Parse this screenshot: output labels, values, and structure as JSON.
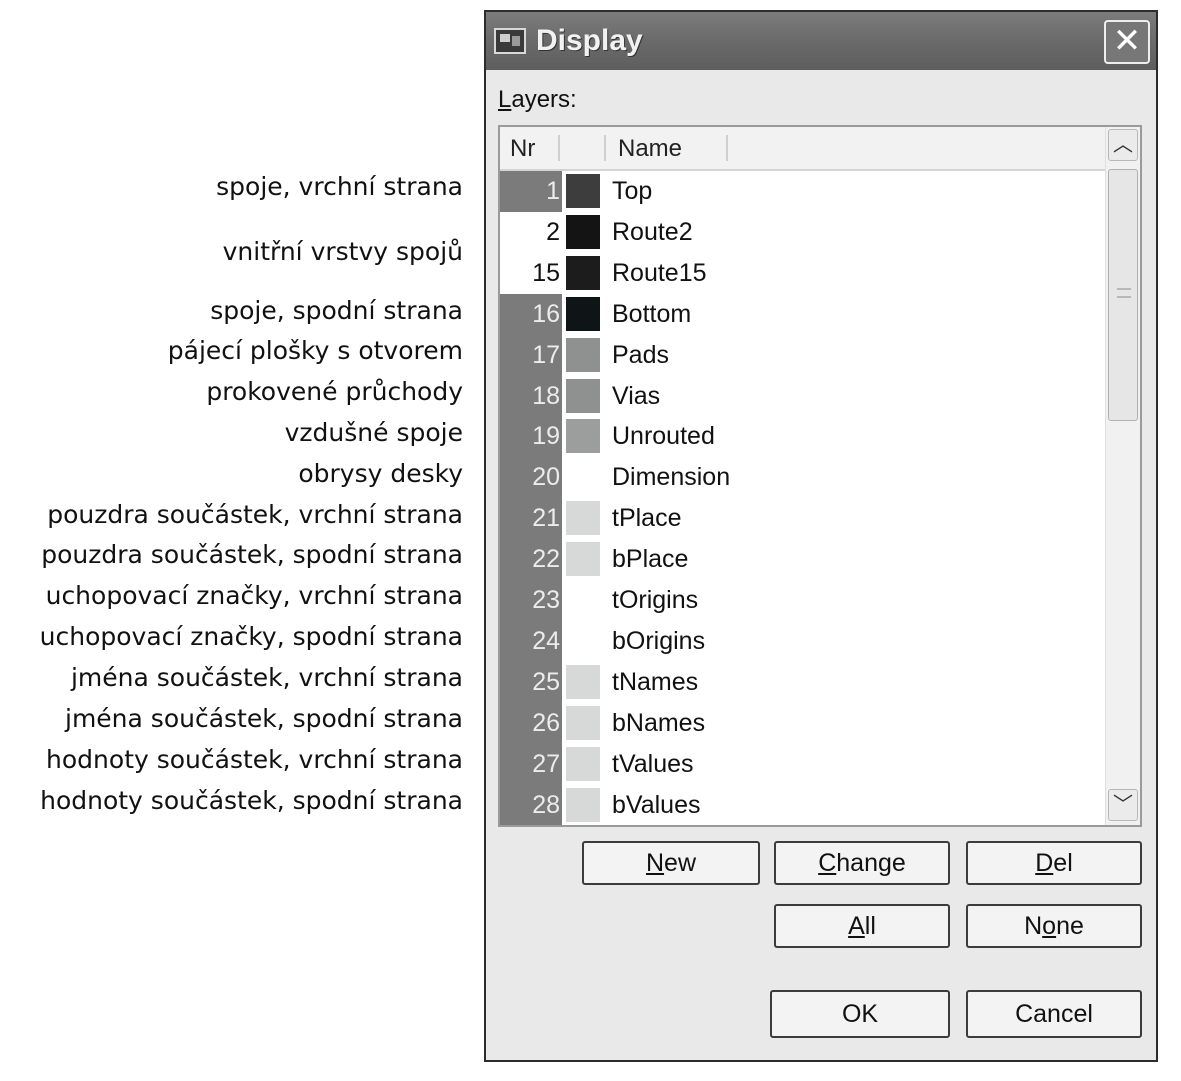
{
  "annotations": [
    "spoje, vrchní strana",
    "vnitřní vrstvy spojů",
    "spoje, spodní strana",
    "pájecí plošky s otvorem",
    "prokovené průchody",
    "vzdušné spoje",
    "obrysy desky",
    "pouzdra součástek, vrchní strana",
    "pouzdra součástek, spodní strana",
    "uchopovací značky, vrchní strana",
    "uchopovací značky, spodní strana",
    "jména součástek, vrchní strana",
    "jména součástek, spodní strana",
    "hodnoty součástek, vrchní strana",
    "hodnoty součástek, spodní strana"
  ],
  "window": {
    "title": "Display",
    "app_icon": "eagle-app-icon",
    "close_icon": "close-icon"
  },
  "layers_label": "Layers:",
  "list": {
    "columns": [
      "Nr",
      "Name"
    ],
    "rows": [
      {
        "nr": "1",
        "name": "Top",
        "color": "#3d3d3d",
        "selected": true
      },
      {
        "nr": "2",
        "name": "Route2",
        "color": "#141414",
        "selected": false
      },
      {
        "nr": "15",
        "name": "Route15",
        "color": "#1c1c1c",
        "selected": false
      },
      {
        "nr": "16",
        "name": "Bottom",
        "color": "#0f1517",
        "selected": true
      },
      {
        "nr": "17",
        "name": "Pads",
        "color": "#8f9190",
        "selected": true
      },
      {
        "nr": "18",
        "name": "Vias",
        "color": "#8f9190",
        "selected": true
      },
      {
        "nr": "19",
        "name": "Unrouted",
        "color": "#9c9e9d",
        "selected": true
      },
      {
        "nr": "20",
        "name": "Dimension",
        "color": "#ffffff",
        "selected": true
      },
      {
        "nr": "21",
        "name": "tPlace",
        "color": "#d7d9d9",
        "selected": true
      },
      {
        "nr": "22",
        "name": "bPlace",
        "color": "#d7d9d9",
        "selected": true
      },
      {
        "nr": "23",
        "name": "tOrigins",
        "color": "#ffffff",
        "selected": true
      },
      {
        "nr": "24",
        "name": "bOrigins",
        "color": "#ffffff",
        "selected": true
      },
      {
        "nr": "25",
        "name": "tNames",
        "color": "#d7d9d9",
        "selected": true
      },
      {
        "nr": "26",
        "name": "bNames",
        "color": "#d7d9d9",
        "selected": true
      },
      {
        "nr": "27",
        "name": "tValues",
        "color": "#d7d9d9",
        "selected": true
      },
      {
        "nr": "28",
        "name": "bValues",
        "color": "#d7d9d9",
        "selected": true
      }
    ],
    "scroll_up_icon": "chevron-up-icon",
    "scroll_down_icon": "chevron-down-icon"
  },
  "buttons": {
    "new": "New",
    "change": "Change",
    "del": "Del",
    "all": "All",
    "none": "None",
    "ok": "OK",
    "cancel": "Cancel"
  }
}
